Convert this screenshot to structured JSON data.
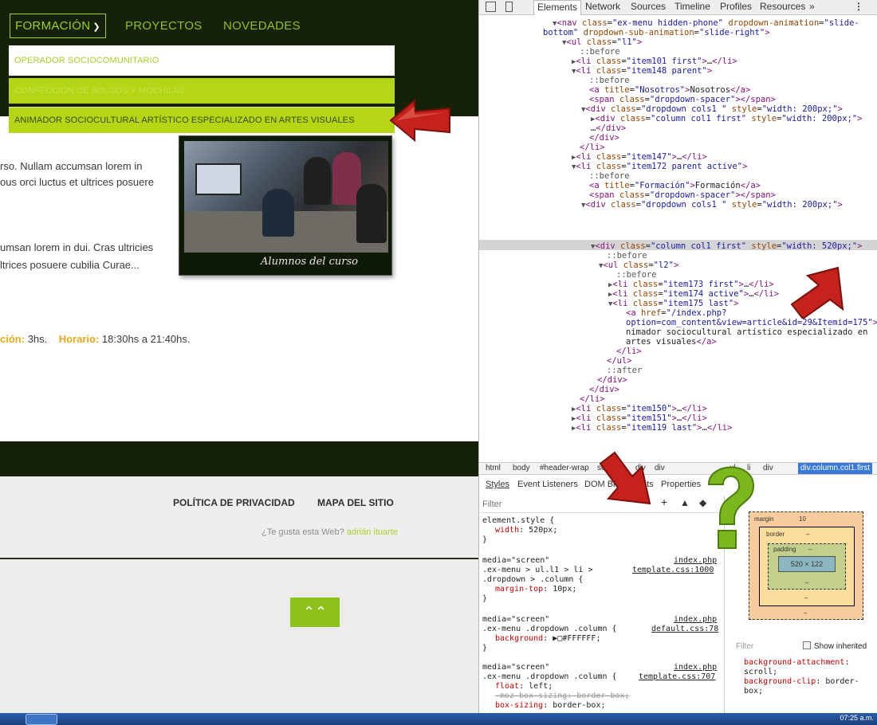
{
  "site": {
    "nav": {
      "items": [
        "FORMACIÓN",
        "PROYECTOS",
        "NOVEDADES"
      ],
      "dropdown": [
        "OPERADOR SOCIOCOMUNITARIO",
        "CONFECCIÓN DE BOLSOS Y MOCHILAS",
        "ANIMADOR SOCIOCULTURAL ARTÍSTICO ESPECIALIZADO EN ARTES VISUALES"
      ]
    },
    "content": {
      "para1_line1": "rso. Nullam accumsan lorem in",
      "para1_line2": "ous orci luctus et ultrices posuere",
      "para2_line1": "umsan lorem in dui. Cras ultricies",
      "para2_line2": "ltrices posuere cubilia Curae...",
      "photo_caption": "Alumnos del curso",
      "duration_label": "ción:",
      "duration_value": "3hs.",
      "schedule_label": "Horario:",
      "schedule_value": "18:30hs a 21:40hs."
    },
    "footer": {
      "links": [
        "POLÍTICA DE PRIVACIDAD",
        "MAPA DEL SITIO"
      ],
      "credit_text": "¿Te gusta esta Web?",
      "credit_author": "adrián ituarte"
    },
    "to_top_icon": "double-chevron-up-icon"
  },
  "devtools": {
    "tabs": [
      "Elements",
      "Network",
      "Sources",
      "Timeline",
      "Profiles",
      "Resources",
      "»"
    ],
    "breadcrumbs": [
      "html",
      "body",
      "#header-wrap",
      "section",
      "div",
      "div",
      "ul",
      "li",
      "div",
      "div.column.col1.first"
    ],
    "styles_tabs": [
      "Styles",
      "Event Listeners",
      "DOM Breakpoints",
      "Properties"
    ],
    "filter_placeholder": "Filter",
    "box_model": {
      "margin_label": "margin",
      "margin_value": "10",
      "border_label": "border",
      "padding_label": "padding",
      "dash": "–",
      "content_size": "520 × 122"
    },
    "computed_filter": "Filter",
    "show_inherited": "Show inherited",
    "clock": "07:25 a.m."
  },
  "colors": {
    "site_header": "#152207",
    "accent_green": "#8cc219",
    "dropdown_active": "#b4d614",
    "selection_blue": "#3879d9"
  }
}
